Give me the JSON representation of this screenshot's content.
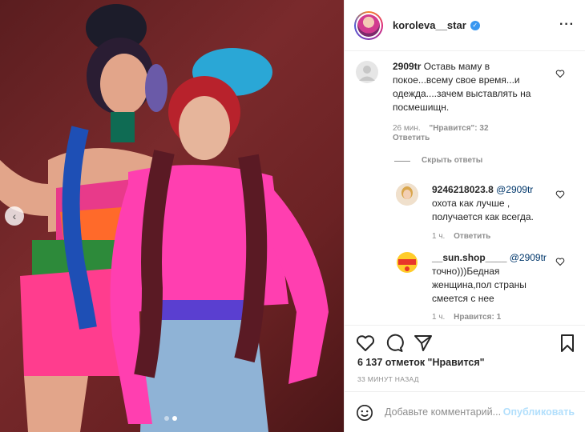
{
  "post": {
    "username": "koroleva__star",
    "verified_icon": "verified-check-icon",
    "more_icon": "more-options-icon"
  },
  "comments": [
    {
      "username": "2909tr",
      "text_line1": "Оставь маму в",
      "text_line2": "покое...всему свое время...и",
      "text_line3": "одежда....зачем выставлять на",
      "text_line4": "посмешищн.",
      "time": "26 мин.",
      "likes": "\"Нравится\": 32",
      "reply_label": "Ответить"
    }
  ],
  "hide_replies_label": "Скрыть ответы",
  "replies": [
    {
      "username": "9246218023.8",
      "mention": "@2909tr",
      "text_line1": "охота как лучше ,",
      "text_line2": "получается как всегда.",
      "time": "1 ч.",
      "reply_label": "Ответить"
    },
    {
      "username": "__sun.shop____",
      "mention": "@2909tr",
      "text_line1": "точно)))Бедная",
      "text_line2": "женщина,пол страны",
      "text_line3": "смеется с нее",
      "time": "1 ч.",
      "likes": "Нравится: 1"
    }
  ],
  "likes_summary": "6 137 отметок \"Нравится\"",
  "time_posted": "33 МИНУТ НАЗАД",
  "comment_box": {
    "placeholder": "Добавьте комментарий...",
    "publish_label": "Опубликовать"
  },
  "colors": {
    "link_blue": "#00376b",
    "publish_disabled": "#b2dffc",
    "verified_blue": "#3897f0"
  }
}
